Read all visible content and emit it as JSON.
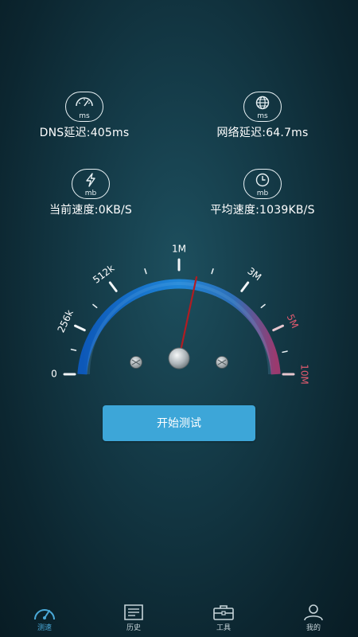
{
  "stats": {
    "dns": {
      "unit": "ms",
      "text": "DNS延迟:405ms",
      "icon": "gauge-icon"
    },
    "network": {
      "unit": "ms",
      "text": "网络延迟:64.7ms",
      "icon": "globe-icon"
    },
    "current": {
      "unit": "mb",
      "text": "当前速度:0KB/S",
      "icon": "lightning-icon"
    },
    "average": {
      "unit": "mb",
      "text": "平均速度:1039KB/S",
      "icon": "clock-icon"
    }
  },
  "gauge": {
    "labels": [
      "0",
      "256k",
      "512k",
      "1M",
      "3M",
      "5M",
      "10M"
    ],
    "needle_value_label": "1M",
    "accent_colors": {
      "arc_start": "#1466c7",
      "arc_end": "#c63a6a",
      "needle": "#b01c22"
    }
  },
  "start_button": {
    "label": "开始测试",
    "color": "#3da6d8"
  },
  "tabs": [
    {
      "label": "测速",
      "icon": "speedometer-icon",
      "active": true
    },
    {
      "label": "历史",
      "icon": "document-icon",
      "active": false
    },
    {
      "label": "工具",
      "icon": "toolbox-icon",
      "active": false
    },
    {
      "label": "我的",
      "icon": "user-icon",
      "active": false
    }
  ]
}
